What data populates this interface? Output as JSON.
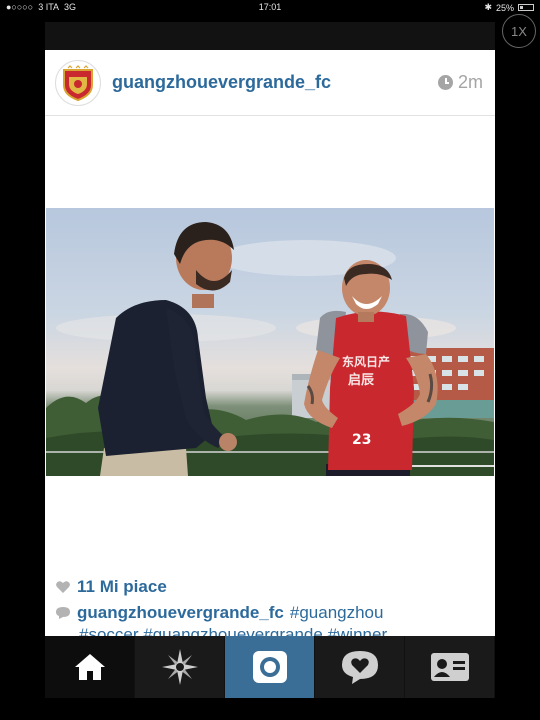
{
  "status": {
    "carrier": "3 ITA",
    "network": "3G",
    "time": "17:01",
    "battery": "25%"
  },
  "zoom_button": "1X",
  "post": {
    "username": "guangzhouevergrande_fc",
    "time_ago": "2m",
    "likes": "11 Mi piace",
    "caption_user": "guangzhouevergrande_fc",
    "caption_tag": "#guangzhou",
    "caption_line2": "#soccer #guangzhouevergrande #winner"
  },
  "photo": {
    "jersey_number": "23"
  },
  "tabbar": {
    "items": [
      "home-icon",
      "explore-icon",
      "camera-icon",
      "activity-icon",
      "profile-icon"
    ],
    "active": "home-icon"
  },
  "colors": {
    "link_blue": "#2d6a9c",
    "camera_tab": "#3b6e97",
    "jersey_red": "#c8282e"
  }
}
